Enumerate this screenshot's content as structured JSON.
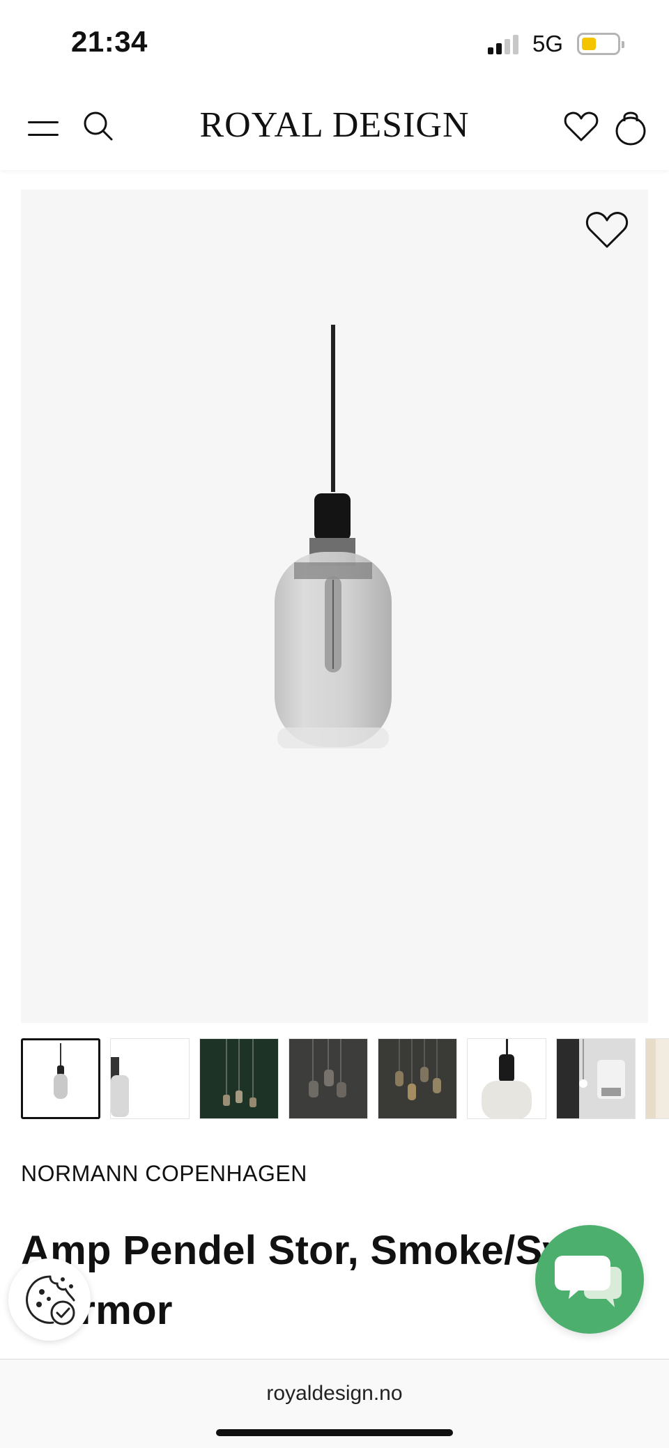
{
  "status_bar": {
    "time": "21:34",
    "network": "5G",
    "signal_bars": 2,
    "signal_bars_total": 4,
    "battery_level": 0.4,
    "battery_color": "#f5c400"
  },
  "header": {
    "logo": "ROYAL DESIGN",
    "icons": [
      "menu-icon",
      "search-icon",
      "heart-icon",
      "shopping-bag-icon"
    ]
  },
  "product": {
    "image_background": "#f6f6f6",
    "favorite_icon": "heart-icon",
    "thumbnail_count": 8,
    "selected_thumbnail": 1,
    "brand": "NORMANN COPENHAGEN",
    "title": "Amp Pendel Stor, Smoke/Svart marmor"
  },
  "floating": {
    "cookie_icon": "cookie-icon",
    "chat_icon": "chat-bubbles-icon",
    "chat_color": "#4caf6e"
  },
  "browser": {
    "url": "royaldesign.no"
  }
}
